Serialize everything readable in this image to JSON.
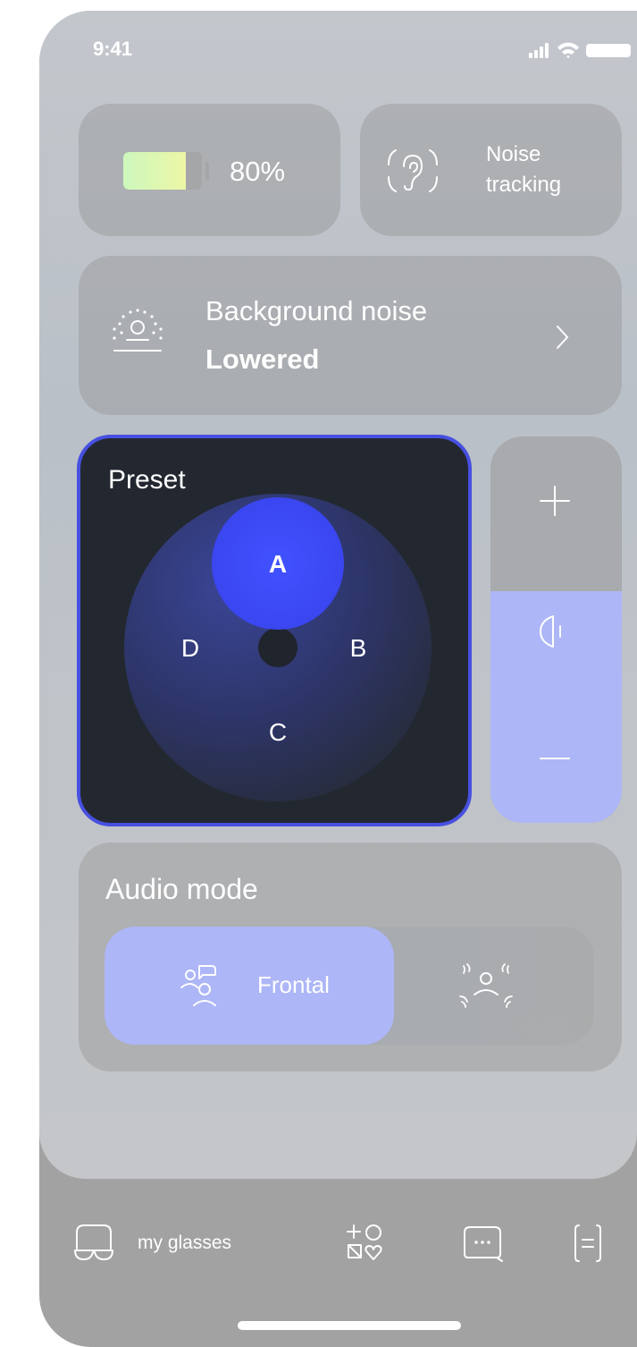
{
  "status_bar": {
    "time": "9:41",
    "icons": [
      "cellular-signal-icon",
      "wifi-icon",
      "battery-icon"
    ]
  },
  "battery": {
    "percent_label": "80%",
    "level": 0.8
  },
  "noise_tracking": {
    "label": "Noise tracking"
  },
  "background_noise": {
    "title": "Background noise",
    "value": "Lowered"
  },
  "preset": {
    "title": "Preset",
    "options": [
      "A",
      "B",
      "C",
      "D"
    ],
    "selected": "A"
  },
  "volume": {
    "level": 0.6,
    "icons": [
      "plus-icon",
      "speaker-icon",
      "minus-icon"
    ]
  },
  "audio_mode": {
    "title": "Audio mode",
    "options": [
      {
        "label": "Frontal",
        "icon": "frontal-speaker-icon",
        "selected": true
      },
      {
        "label": "",
        "icon": "surround-speaker-icon",
        "selected": false
      }
    ]
  },
  "bottom_nav": [
    {
      "icon": "glasses-icon",
      "label": "my glasses",
      "active": true
    },
    {
      "icon": "add-shapes-icon",
      "label": ""
    },
    {
      "icon": "chat-icon",
      "label": ""
    },
    {
      "icon": "document-icon",
      "label": ""
    }
  ],
  "colors": {
    "accent": "#4750e0",
    "preset_selected": "#3e49f5",
    "volume_fill": "#adb6f6",
    "mode_active": "#adb6f6",
    "preset_bg": "#232830"
  }
}
